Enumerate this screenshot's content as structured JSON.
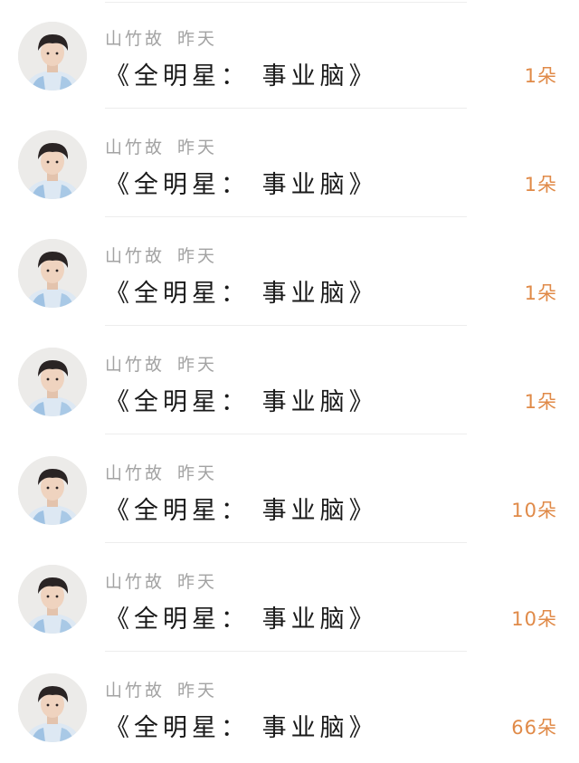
{
  "items": [
    {
      "username": "山竹故",
      "time": "昨天",
      "title": "《全明星： 事业脑》",
      "count": "1朵"
    },
    {
      "username": "山竹故",
      "time": "昨天",
      "title": "《全明星： 事业脑》",
      "count": "1朵"
    },
    {
      "username": "山竹故",
      "time": "昨天",
      "title": "《全明星： 事业脑》",
      "count": "1朵"
    },
    {
      "username": "山竹故",
      "time": "昨天",
      "title": "《全明星： 事业脑》",
      "count": "1朵"
    },
    {
      "username": "山竹故",
      "time": "昨天",
      "title": "《全明星： 事业脑》",
      "count": "10朵"
    },
    {
      "username": "山竹故",
      "time": "昨天",
      "title": "《全明星： 事业脑》",
      "count": "10朵"
    },
    {
      "username": "山竹故",
      "time": "昨天",
      "title": "《全明星： 事业脑》",
      "count": "66朵"
    }
  ],
  "colors": {
    "username": "#a3a3a3",
    "title": "#1a1a1a",
    "count": "#e08a48",
    "divider": "#ededed"
  }
}
